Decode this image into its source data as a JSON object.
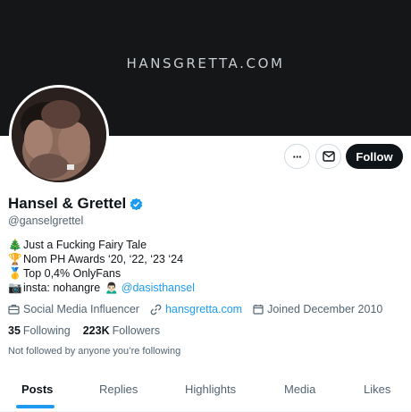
{
  "banner": {
    "text": "HANSGRETTA.COM"
  },
  "profile": {
    "name": "Hansel & Grettel",
    "handle": "@ganselgrettel",
    "verified": true,
    "bio": [
      {
        "emoji": "🎄",
        "text": "Just a Fucking Fairy Tale"
      },
      {
        "emoji": "🏆",
        "text": "Nom PH Awards ‘20, ‘22, ‘23 ‘24"
      },
      {
        "emoji": "🥇",
        "text": "Top 0,4% OnlyFans"
      },
      {
        "emoji": "📷",
        "text": "insta: nohangre",
        "emoji2": "🙍🏻‍♂️",
        "mention": "@dasisthansel"
      }
    ],
    "category": "Social Media Influencer",
    "website": "hansgretta.com",
    "joined": "Joined December 2010",
    "following_count": "35",
    "following_label": "Following",
    "followers_count": "223K",
    "followers_label": "Followers",
    "followed_by": "Not followed by anyone you’re following"
  },
  "actions": {
    "more": "···",
    "follow": "Follow"
  },
  "tabs": [
    {
      "label": "Posts",
      "active": true
    },
    {
      "label": "Replies"
    },
    {
      "label": "Highlights"
    },
    {
      "label": "Media"
    },
    {
      "label": "Likes"
    }
  ],
  "colors": {
    "accent": "#1d9bf0",
    "text": "#0f1419",
    "secondary": "#536471",
    "banner": "#141617"
  }
}
